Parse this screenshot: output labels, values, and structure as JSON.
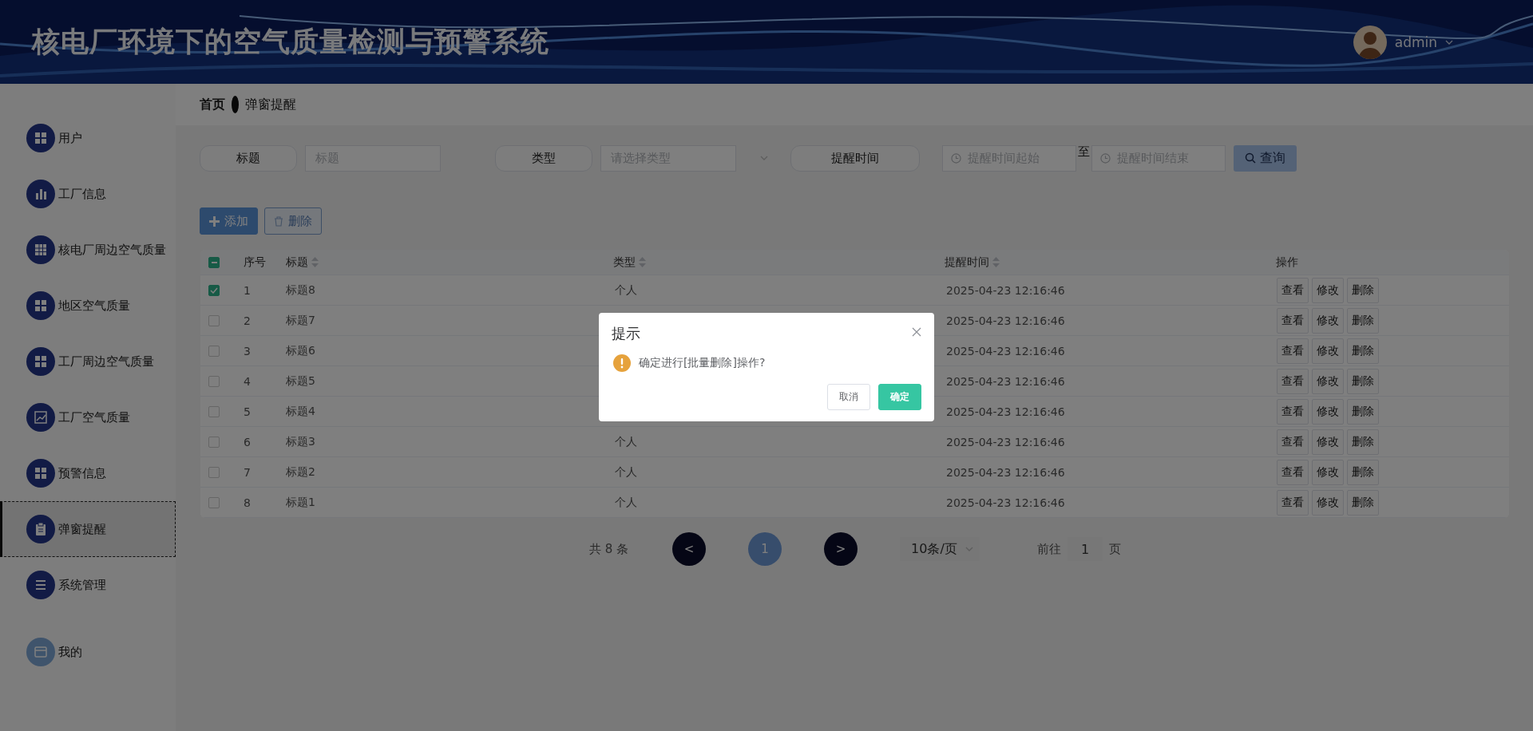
{
  "header": {
    "title": "核电厂环境下的空气质量检测与预警系统",
    "user": {
      "name": "admin"
    }
  },
  "sidebar": {
    "items": [
      {
        "label": "用户",
        "kind": "grid",
        "selected": false
      },
      {
        "label": "工厂信息",
        "kind": "bars",
        "selected": false
      },
      {
        "label": "核电厂周边空气质量",
        "kind": "table",
        "selected": false
      },
      {
        "label": "地区空气质量",
        "kind": "grid",
        "selected": false
      },
      {
        "label": "工厂周边空气质量",
        "kind": "grid",
        "selected": false
      },
      {
        "label": "工厂空气质量",
        "kind": "chart",
        "selected": false
      },
      {
        "label": "预警信息",
        "kind": "grid",
        "selected": false
      },
      {
        "label": "弹窗提醒",
        "kind": "clipboard",
        "selected": true
      },
      {
        "label": "系统管理",
        "kind": "list",
        "selected": false
      },
      {
        "label": "我的",
        "kind": "card",
        "selected": false
      }
    ]
  },
  "breadcrumb": [
    "首页",
    "弹窗提醒"
  ],
  "search": {
    "fields": [
      {
        "kind": "text",
        "label": "标题",
        "placeholder": "标题"
      },
      {
        "kind": "select",
        "label": "类型",
        "placeholder": "请选择类型"
      },
      {
        "kind": "daterange",
        "label": "提醒时间",
        "start_placeholder": "提醒时间起始",
        "separator": "至",
        "end_placeholder": "提醒时间结束"
      }
    ],
    "query_button": "查询"
  },
  "actions": [
    {
      "kind": "add",
      "label": "添加"
    },
    {
      "kind": "delete",
      "label": "删除"
    }
  ],
  "table": {
    "header_checkbox": {
      "indeterminate": true
    },
    "columns": [
      {
        "label": "序号",
        "sortable": false
      },
      {
        "label": "标题",
        "sortable": true
      },
      {
        "label": "类型",
        "sortable": true
      },
      {
        "label": "提醒时间",
        "sortable": true
      },
      {
        "label": "操作",
        "sortable": false
      }
    ],
    "rows": [
      {
        "selected": true,
        "index": "1",
        "title": "标题8",
        "type": "个人",
        "time": "2025-04-23 12:16:46",
        "actions": [
          "查看",
          "修改",
          "删除"
        ]
      },
      {
        "selected": false,
        "index": "2",
        "title": "标题7",
        "time": "2025-04-23 12:16:46",
        "actions": [
          "查看",
          "修改",
          "删除"
        ]
      },
      {
        "selected": false,
        "index": "3",
        "title": "标题6",
        "time": "2025-04-23 12:16:46",
        "actions": [
          "查看",
          "修改",
          "删除"
        ]
      },
      {
        "selected": false,
        "index": "4",
        "title": "标题5",
        "time": "2025-04-23 12:16:46",
        "actions": [
          "查看",
          "修改",
          "删除"
        ]
      },
      {
        "selected": false,
        "index": "5",
        "title": "标题4",
        "time": "2025-04-23 12:16:46",
        "actions": [
          "查看",
          "修改",
          "删除"
        ]
      },
      {
        "selected": false,
        "index": "6",
        "title": "标题3",
        "type": "个人",
        "time": "2025-04-23 12:16:46",
        "actions": [
          "查看",
          "修改",
          "删除"
        ]
      },
      {
        "selected": false,
        "index": "7",
        "title": "标题2",
        "type": "个人",
        "time": "2025-04-23 12:16:46",
        "actions": [
          "查看",
          "修改",
          "删除"
        ]
      },
      {
        "selected": false,
        "index": "8",
        "title": "标题1",
        "type": "个人",
        "time": "2025-04-23 12:16:46",
        "actions": [
          "查看",
          "修改",
          "删除"
        ]
      }
    ]
  },
  "pagination": {
    "total": "共 8 条",
    "prev": "<",
    "pages": [
      {
        "label": "1",
        "selected": true
      }
    ],
    "next": ">",
    "page_size": "10条/页",
    "jump": {
      "prefix": "前往",
      "value": "1",
      "suffix": "页"
    }
  },
  "dialog": {
    "title": "提示",
    "message": "确定进行[批量删除]操作?",
    "buttons": [
      {
        "kind": "default",
        "label": "取消"
      },
      {
        "kind": "primary",
        "label": "确定"
      }
    ]
  }
}
